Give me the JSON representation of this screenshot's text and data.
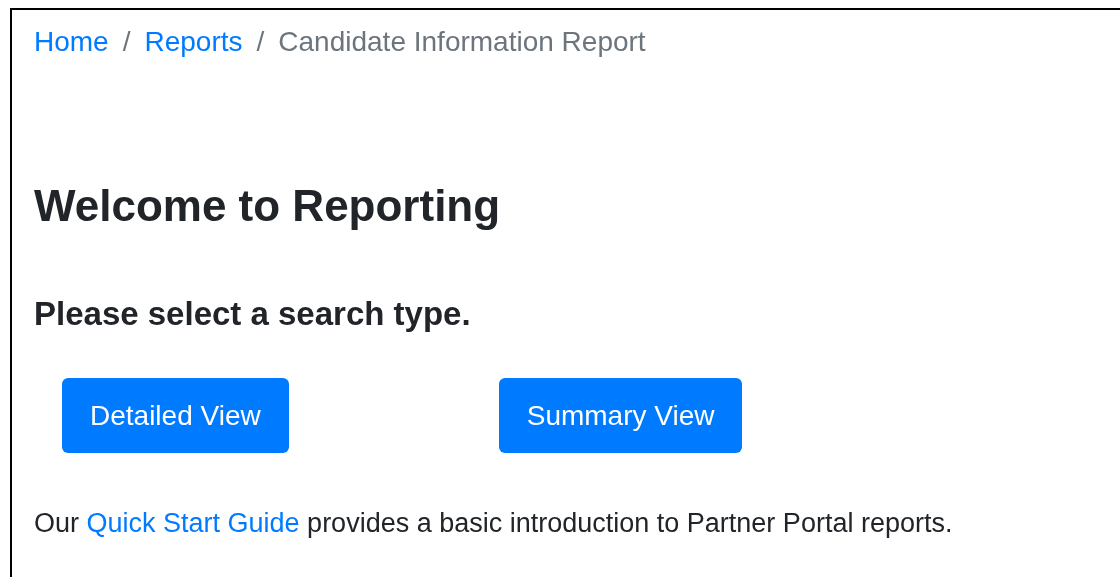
{
  "breadcrumb": [
    {
      "label": "Home",
      "kind": "link"
    },
    {
      "label": "Reports",
      "kind": "link"
    },
    {
      "label": "Candidate Information Report",
      "kind": "current"
    }
  ],
  "separator": "/",
  "title": "Welcome to Reporting",
  "subtitle": "Please select a search type.",
  "buttons": [
    "Detailed View",
    "Summary View"
  ],
  "footer": {
    "before": "Our",
    "link": "Quick Start Guide",
    "after": "provides a basic introduction to Partner Portal reports."
  }
}
